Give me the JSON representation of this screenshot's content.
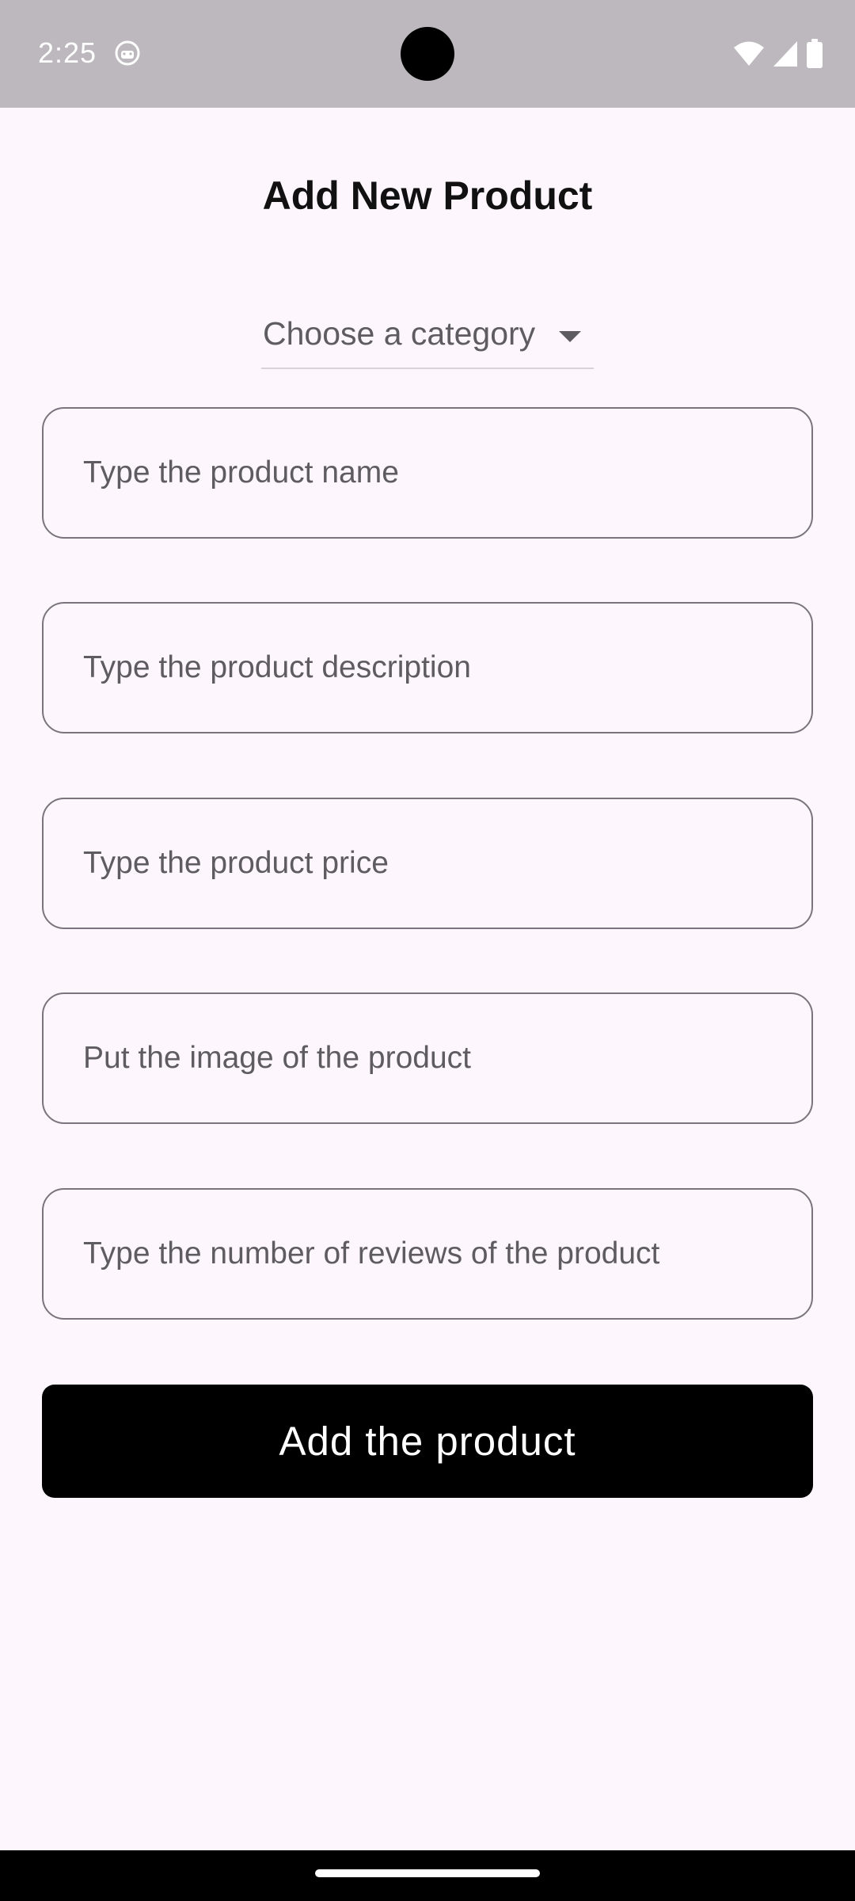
{
  "status_bar": {
    "time": "2:25",
    "notification_icon": "android-debug-icon",
    "right_icons": [
      "wifi-icon",
      "signal-icon",
      "battery-icon"
    ],
    "background_color": "#bcb8bd"
  },
  "header": {
    "title": "Add New Product"
  },
  "form": {
    "category": {
      "placeholder": "Choose a category",
      "icon": "dropdown-arrow-icon"
    },
    "fields": [
      {
        "name": "product-name-input",
        "placeholder": "Type the product name",
        "value": ""
      },
      {
        "name": "product-description-input",
        "placeholder": "Type the product description",
        "value": ""
      },
      {
        "name": "product-price-input",
        "placeholder": "Type the product price",
        "value": ""
      },
      {
        "name": "product-image-input",
        "placeholder": "Put the image of the product",
        "value": ""
      },
      {
        "name": "product-reviews-input",
        "placeholder": "Type the number of reviews of the product",
        "value": ""
      }
    ],
    "submit_label": "Add the product"
  },
  "theme": {
    "background": "#fdf7fd",
    "field_border": "#79747e",
    "button_background": "#000000",
    "button_text": "#ffffff"
  }
}
